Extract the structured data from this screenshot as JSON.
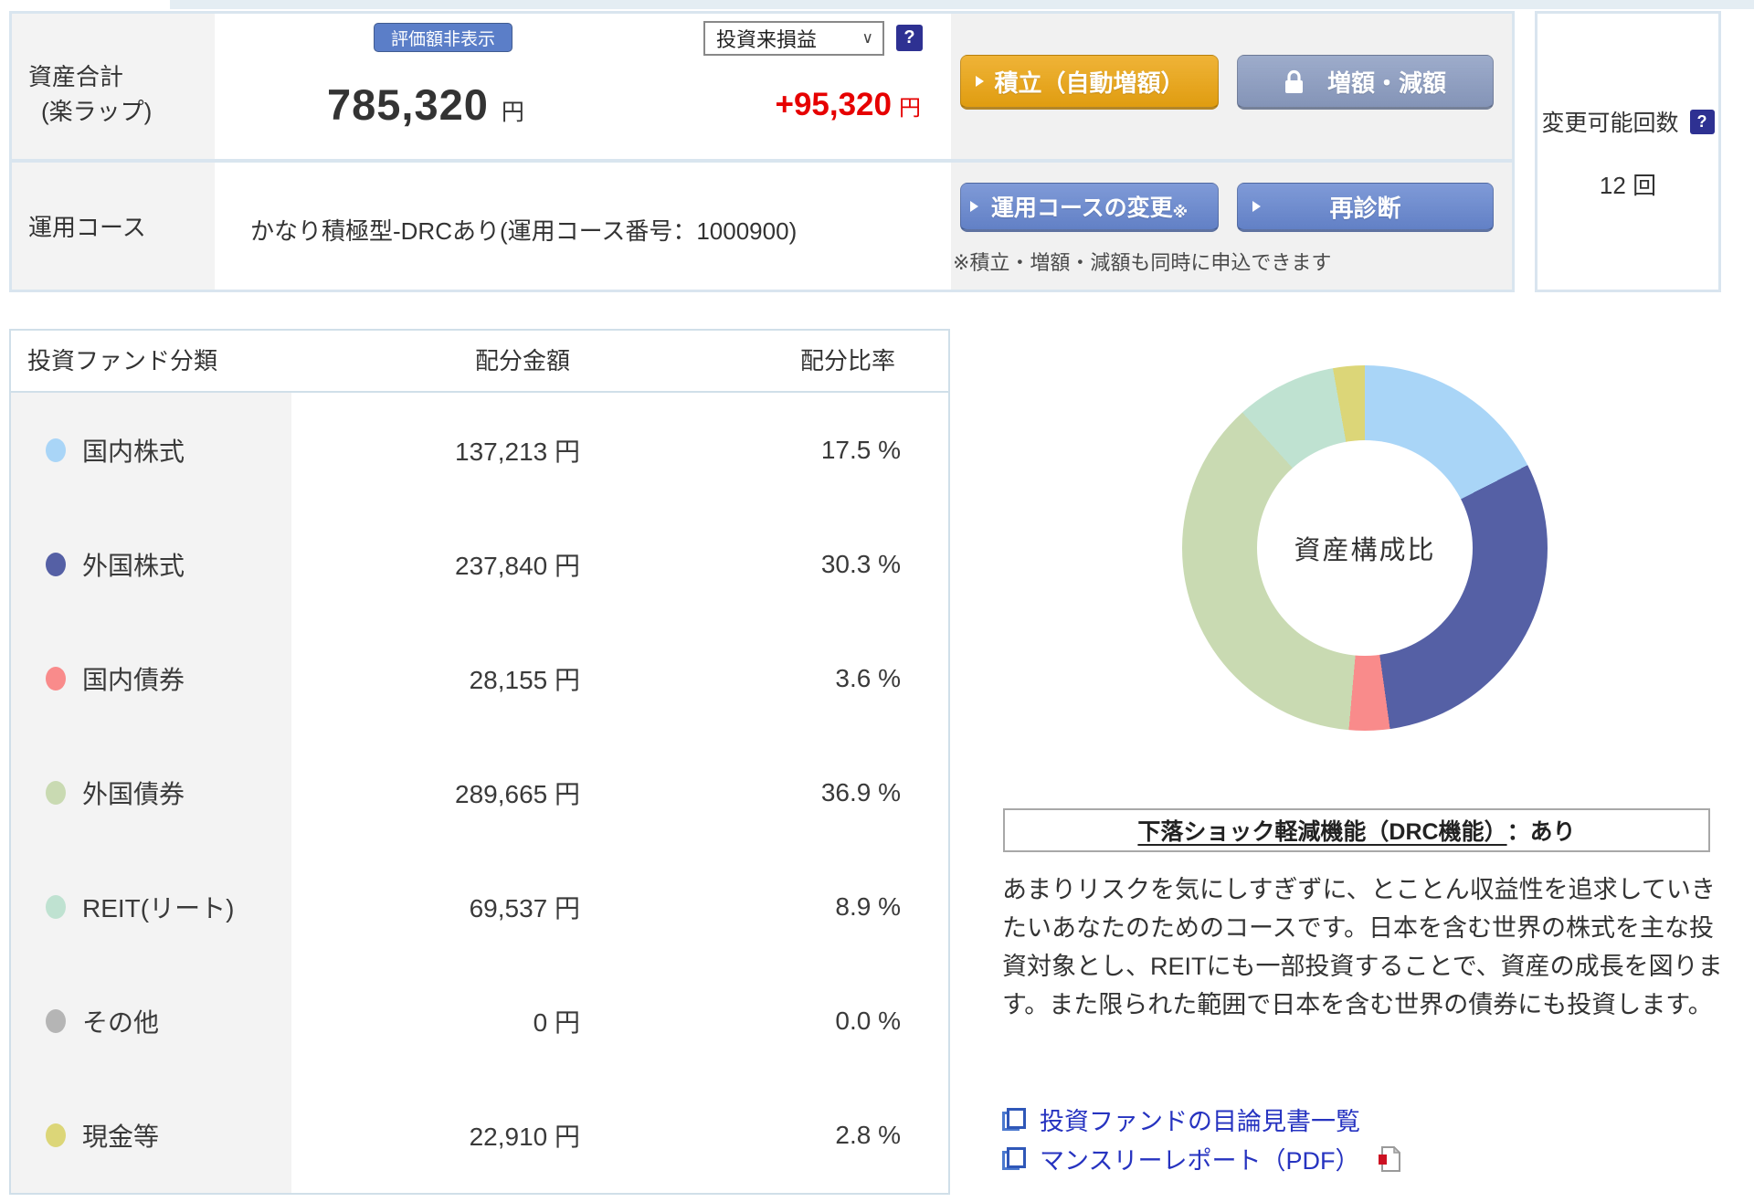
{
  "colors": {
    "panel_border": "#d9e5ef",
    "accent_blue_button": "#5b7ec8",
    "primary_blue_button": "#6787d0",
    "muted_blue_button": "#8b9cc1",
    "action_orange_button": "#eca511",
    "profit_red": "#e60000",
    "link_blue": "#2633c0"
  },
  "icons": {
    "help_glyph": "?",
    "select_chevron": "∨"
  },
  "summary": {
    "row1_label_line1": "資産合計",
    "row1_label_line2": "(楽ラップ)",
    "hide_button": "評価額非表示",
    "total_value": "785,320",
    "total_unit": "円",
    "pl_dropdown_value": "投資来損益",
    "pl_value": "+95,320",
    "pl_unit": "円",
    "reserve_button": "積立（自動増額）",
    "amount_change_button": "増額・減額",
    "row2_label": "運用コース",
    "course_text": "かなり積極型-DRCあり(運用コース番号：1000900)",
    "course_change_button": "運用コースの変更",
    "course_change_suffix": "※",
    "rediagnosis_button": "再診断",
    "note": "※積立・増額・減額も同時に申込できます"
  },
  "change_panel": {
    "label": "変更可能回数",
    "value": "12 回"
  },
  "table": {
    "headers": [
      "投資ファンド分類",
      "配分金額",
      "配分比率"
    ],
    "rows": [
      {
        "label": "国内株式",
        "amount": "137,213 円",
        "ratio": "17.5 %",
        "dot": "#a9d5f7"
      },
      {
        "label": "外国株式",
        "amount": "237,840 円",
        "ratio": "30.3 %",
        "dot": "#5560a5"
      },
      {
        "label": "国内債券",
        "amount": "28,155 円",
        "ratio": "3.6 %",
        "dot": "#f98b8b"
      },
      {
        "label": "外国債券",
        "amount": "289,665 円",
        "ratio": "36.9 %",
        "dot": "#c9dab2"
      },
      {
        "label": "REIT(リート)",
        "amount": "69,537 円",
        "ratio": "8.9 %",
        "dot": "#bfe2d1"
      },
      {
        "label": "その他",
        "amount": "0 円",
        "ratio": "0.0 %",
        "dot": "#b5b5b5"
      },
      {
        "label": "現金等",
        "amount": "22,910 円",
        "ratio": "2.8 %",
        "dot": "#dcd678"
      }
    ]
  },
  "chart_data": {
    "type": "pie",
    "subtype": "donut",
    "center_label": "資産構成比",
    "unit": "%",
    "start_angle_deg": 0,
    "direction": "clockwise",
    "segments": [
      {
        "label": "国内株式",
        "value": 17.5,
        "color": "#a9d5f7"
      },
      {
        "label": "外国株式",
        "value": 30.3,
        "color": "#5560a5"
      },
      {
        "label": "国内債券",
        "value": 3.6,
        "color": "#f98b8b"
      },
      {
        "label": "外国債券",
        "value": 36.9,
        "color": "#c9dab2"
      },
      {
        "label": "REIT(リート)",
        "value": 8.9,
        "color": "#bfe2d1"
      },
      {
        "label": "現金等",
        "value": 2.8,
        "color": "#dcd678"
      }
    ]
  },
  "drc": {
    "title_underlined": "下落ショック軽減機能（DRC機能）",
    "title_rest": "：あり"
  },
  "description": "あまりリスクを気にしすぎずに、とことん収益性を追求していきたいあなたのためのコースです。日本を含む世界の株式を主な投資対象とし、REITにも一部投資することで、資産の成長を図ります。また限られた範囲で日本を含む世界の債券にも投資します。",
  "links": [
    {
      "label": "投資ファンドの目論見書一覧"
    },
    {
      "label": "マンスリーレポート（PDF）"
    }
  ]
}
